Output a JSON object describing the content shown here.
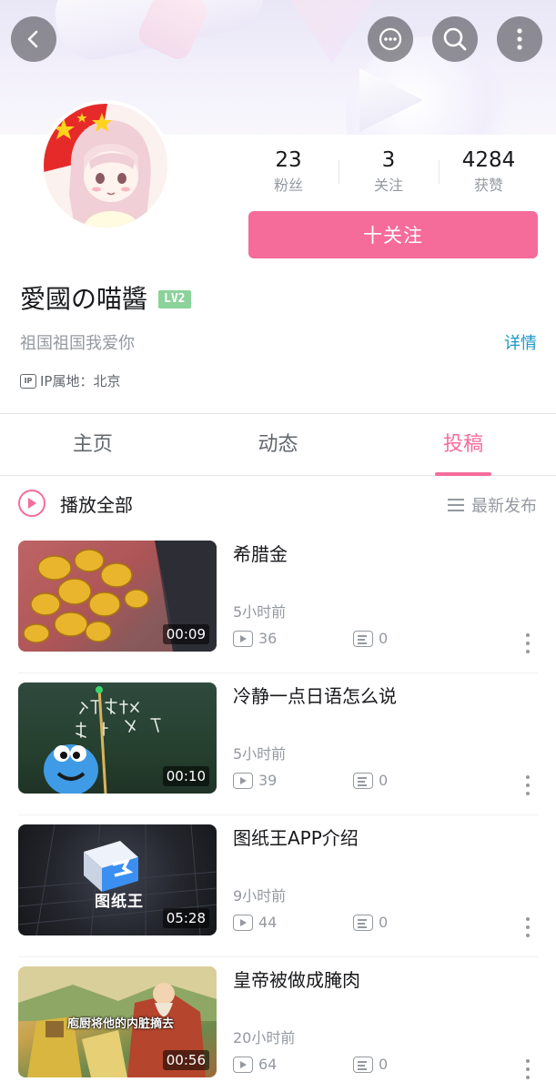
{
  "header": {
    "back_icon": "back-chevron-icon",
    "actions": [
      "message-icon",
      "search-icon",
      "more-vertical-icon"
    ]
  },
  "profile": {
    "stats": [
      {
        "value": "23",
        "label": "粉丝"
      },
      {
        "value": "3",
        "label": "关注"
      },
      {
        "value": "4284",
        "label": "获赞"
      }
    ],
    "follow_label": "十关注",
    "username": "愛國の喵醬",
    "level": "LV2",
    "bio": "祖国祖国我爱你",
    "detail_link": "详情",
    "ip_label": "IP属地：北京",
    "ip_icon_text": "IP"
  },
  "tabs": [
    {
      "label": "主页",
      "active": false
    },
    {
      "label": "动态",
      "active": false
    },
    {
      "label": "投稿",
      "active": true
    }
  ],
  "list_header": {
    "play_all": "播放全部",
    "sort": "最新发布"
  },
  "videos": [
    {
      "title": "希腊金",
      "time": "5小时前",
      "plays": "36",
      "danmu": "0",
      "duration": "00:09"
    },
    {
      "title": "冷静一点日语怎么说",
      "time": "5小时前",
      "plays": "39",
      "danmu": "0",
      "duration": "00:10"
    },
    {
      "title": "图纸王APP介绍",
      "time": "9小时前",
      "plays": "44",
      "danmu": "0",
      "duration": "05:28"
    },
    {
      "title": "皇帝被做成腌肉",
      "time": "20小时前",
      "plays": "64",
      "danmu": "0",
      "duration": "00:56"
    }
  ],
  "thumbnail_text": {
    "v3_brand": "图纸王",
    "v4_caption": "庖厨将他的内脏摘去"
  },
  "colors": {
    "accent_pink": "#f56c9b",
    "link_blue": "#1a97c7",
    "level_green": "#8bd29b",
    "text_gray": "#9499a0"
  }
}
